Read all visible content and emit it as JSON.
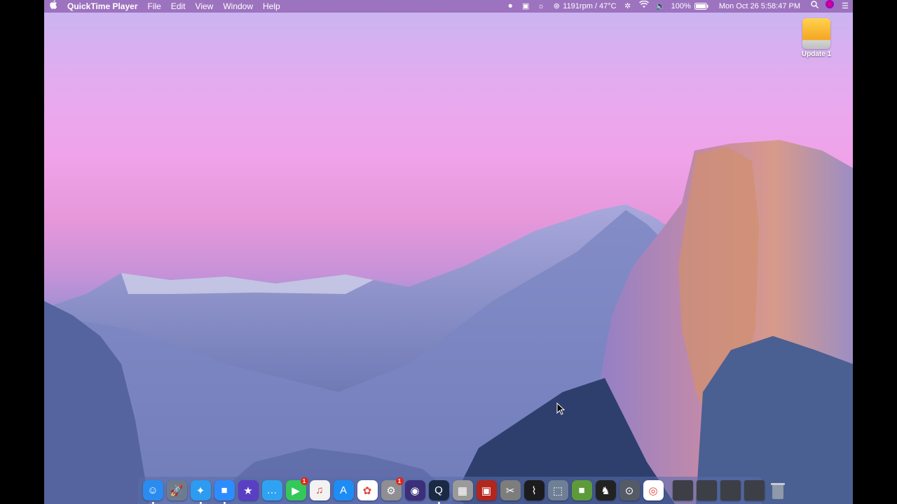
{
  "menubar": {
    "apple": "",
    "app_name": "QuickTime Player",
    "menus": [
      "File",
      "Edit",
      "View",
      "Window",
      "Help"
    ],
    "status": {
      "fan": "1191rpm / 47°C",
      "battery": "100%",
      "datetime": "Mon Oct 26  5:58:47 PM"
    }
  },
  "desktop": {
    "drive_label": "Update 1"
  },
  "dock": {
    "apps": [
      {
        "name": "Finder",
        "color": "#2a8cf0",
        "glyph": "☺",
        "running": true
      },
      {
        "name": "Launchpad",
        "color": "#6e7b8f",
        "glyph": "🚀",
        "running": false
      },
      {
        "name": "Safari",
        "color": "#2d9bf0",
        "glyph": "✦",
        "running": true
      },
      {
        "name": "Zoom",
        "color": "#2d8cff",
        "glyph": "■",
        "running": true
      },
      {
        "name": "iMovie",
        "color": "#5a3fc4",
        "glyph": "★",
        "running": false
      },
      {
        "name": "Messages",
        "color": "#2fa3f2",
        "glyph": "…",
        "running": false
      },
      {
        "name": "FaceTime",
        "color": "#34c759",
        "glyph": "▶",
        "running": false,
        "badge": "1"
      },
      {
        "name": "Music",
        "color": "#f2f2f2",
        "glyph": "♫",
        "running": false
      },
      {
        "name": "App Store",
        "color": "#1e8cf5",
        "glyph": "A",
        "running": false
      },
      {
        "name": "Photos",
        "color": "#ffffff",
        "glyph": "✿",
        "running": false
      },
      {
        "name": "System Preferences",
        "color": "#8e8e93",
        "glyph": "⚙",
        "running": false,
        "badge": "1"
      },
      {
        "name": "Siri",
        "color": "#3b2f7a",
        "glyph": "◉",
        "running": false
      },
      {
        "name": "QuickTime Player",
        "color": "#1b2a44",
        "glyph": "Q",
        "running": true
      },
      {
        "name": "Calculator",
        "color": "#9a9a9a",
        "glyph": "▦",
        "running": false
      },
      {
        "name": "Photo Booth",
        "color": "#b3261e",
        "glyph": "▣",
        "running": false
      },
      {
        "name": "Screenshot",
        "color": "#7d7d7d",
        "glyph": "✂",
        "running": false
      },
      {
        "name": "Activity Monitor",
        "color": "#1c1c1e",
        "glyph": "⌇",
        "running": false
      },
      {
        "name": "VirtualBox",
        "color": "#6f7f95",
        "glyph": "⬚",
        "running": false
      },
      {
        "name": "Minecraft",
        "color": "#5d9b3a",
        "glyph": "■",
        "running": false
      },
      {
        "name": "Chess",
        "color": "#222222",
        "glyph": "♞",
        "running": false
      },
      {
        "name": "Boot Camp",
        "color": "#555b66",
        "glyph": "⊙",
        "running": false
      },
      {
        "name": "Chrome",
        "color": "#ffffff",
        "glyph": "◎",
        "running": false
      }
    ],
    "stacks": [
      {
        "name": "stack-1",
        "color": "#3c3f46"
      },
      {
        "name": "stack-2",
        "color": "#3c3f46"
      },
      {
        "name": "stack-3",
        "color": "#3c3f46"
      },
      {
        "name": "stack-4",
        "color": "#3c3f46"
      }
    ],
    "trash": {
      "name": "Trash",
      "color": "#9aa3ad"
    }
  }
}
